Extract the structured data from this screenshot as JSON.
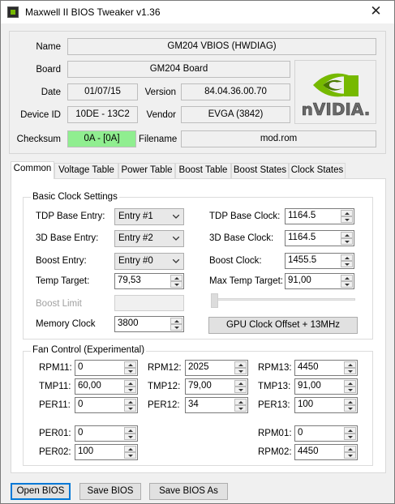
{
  "window": {
    "title": "Maxwell II BIOS Tweaker v1.36",
    "close_glyph": "✕"
  },
  "info": {
    "name_label": "Name",
    "name_value": "GM204 VBIOS (HWDIAG)",
    "board_label": "Board",
    "board_value": "GM204 Board",
    "date_label": "Date",
    "date_value": "01/07/15",
    "version_label": "Version",
    "version_value": "84.04.36.00.70",
    "device_label": "Device ID",
    "device_value": "10DE - 13C2",
    "vendor_label": "Vendor",
    "vendor_value": "EVGA (3842)",
    "checksum_label": "Checksum",
    "checksum_value": "0A - [0A]",
    "filename_label": "Filename",
    "filename_value": "mod.rom",
    "logo_text": "nVIDIA."
  },
  "tabs": [
    "Common",
    "Voltage Table",
    "Power Table",
    "Boost Table",
    "Boost States",
    "Clock States"
  ],
  "basic": {
    "title": "Basic Clock Settings",
    "tdp_base_entry_label": "TDP Base Entry:",
    "tdp_base_entry_value": "Entry #1",
    "base3d_entry_label": "3D Base Entry:",
    "base3d_entry_value": "Entry #2",
    "boost_entry_label": "Boost Entry:",
    "boost_entry_value": "Entry #0",
    "temp_target_label": "Temp Target:",
    "temp_target_value": "79,53",
    "boost_limit_label": "Boost Limit",
    "memory_clock_label": "Memory Clock",
    "memory_clock_value": "3800",
    "tdp_base_clock_label": "TDP Base Clock:",
    "tdp_base_clock_value": "1164.5",
    "base3d_clock_label": "3D Base Clock:",
    "base3d_clock_value": "1164.5",
    "boost_clock_label": "Boost Clock:",
    "boost_clock_value": "1455.5",
    "max_temp_label": "Max Temp Target:",
    "max_temp_value": "91,00",
    "offset_button": "GPU Clock Offset + 13MHz"
  },
  "fan": {
    "title": "Fan Control (Experimental)",
    "rpm11_label": "RPM11:",
    "rpm11_value": "0",
    "rpm12_label": "RPM12:",
    "rpm12_value": "2025",
    "rpm13_label": "RPM13:",
    "rpm13_value": "4450",
    "tmp11_label": "TMP11:",
    "tmp11_value": "60,00",
    "tmp12_label": "TMP12:",
    "tmp12_value": "79,00",
    "tmp13_label": "TMP13:",
    "tmp13_value": "91,00",
    "per11_label": "PER11:",
    "per11_value": "0",
    "per12_label": "PER12:",
    "per12_value": "34",
    "per13_label": "PER13:",
    "per13_value": "100",
    "per01_label": "PER01:",
    "per01_value": "0",
    "per02_label": "PER02:",
    "per02_value": "100",
    "rpm01_label": "RPM01:",
    "rpm01_value": "0",
    "rpm02_label": "RPM02:",
    "rpm02_value": "4450"
  },
  "buttons": {
    "open": "Open BIOS",
    "save": "Save BIOS",
    "save_as": "Save BIOS As"
  },
  "colors": {
    "checksum_ok": "#90ee90",
    "nvidia_green": "#76b900",
    "focus_blue": "#0078d7"
  }
}
